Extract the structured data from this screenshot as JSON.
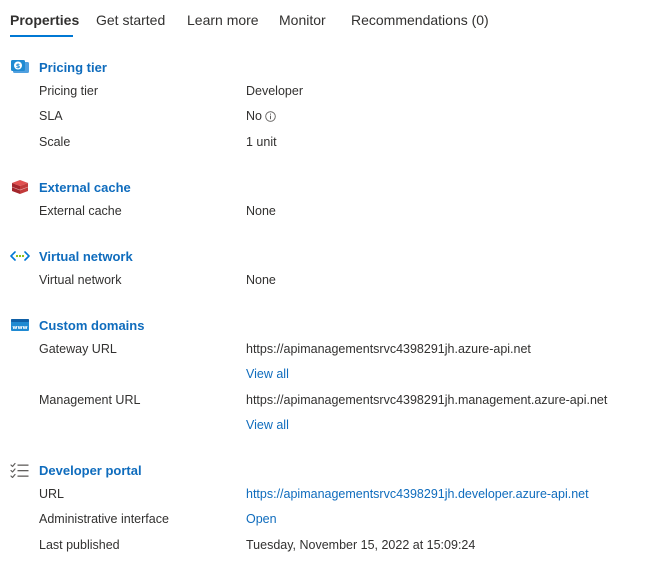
{
  "tabs": [
    {
      "label": "Properties",
      "active": true
    },
    {
      "label": "Get started"
    },
    {
      "label": "Learn more"
    },
    {
      "label": "Monitor"
    },
    {
      "label": "Recommendations (0)"
    }
  ],
  "colors": {
    "accent": "#0078d4",
    "link": "#0f6cbd",
    "text": "#323130"
  },
  "pricing": {
    "title": "Pricing tier",
    "icon": "pricing-tier-icon",
    "rows": [
      {
        "label": "Pricing tier",
        "value": "Developer"
      },
      {
        "label": "SLA",
        "value": "No"
      },
      {
        "label": "Scale",
        "value": "1 unit"
      }
    ]
  },
  "cache": {
    "title": "External cache",
    "icon": "cache-icon",
    "rows": [
      {
        "label": "External cache",
        "value": "None"
      }
    ]
  },
  "vnet": {
    "title": "Virtual network",
    "icon": "virtual-network-icon",
    "rows": [
      {
        "label": "Virtual network",
        "value": "None"
      }
    ]
  },
  "domains": {
    "title": "Custom domains",
    "icon": "www-icon",
    "gateway_label": "Gateway URL",
    "gateway_url": "https://apimanagementsrvc4398291jh.azure-api.net",
    "gateway_view_all": "View all",
    "management_label": "Management URL",
    "management_url": "https://apimanagementsrvc4398291jh.management.azure-api.net",
    "management_view_all": "View all"
  },
  "portal": {
    "title": "Developer portal",
    "icon": "checklist-icon",
    "url_label": "URL",
    "url_value": "https://apimanagementsrvc4398291jh.developer.azure-api.net",
    "admin_label": "Administrative interface",
    "admin_value": "Open",
    "published_label": "Last published",
    "published_value": "Tuesday, November 15, 2022 at 15:09:24"
  }
}
